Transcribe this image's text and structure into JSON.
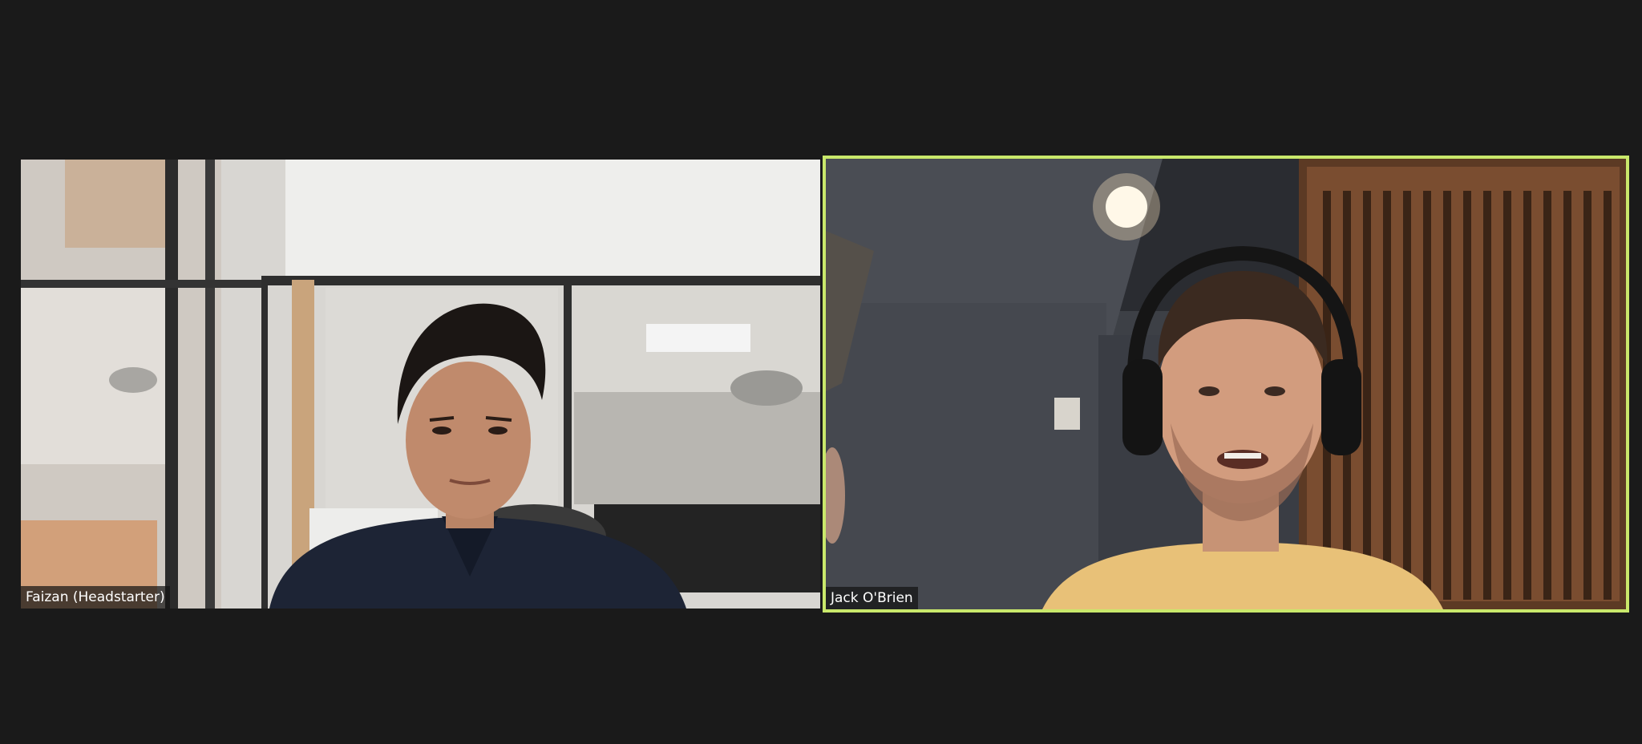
{
  "meeting": {
    "participants": [
      {
        "name": "Faizan (Headstarter)",
        "active_speaker": false,
        "video_scene": "young man in navy shirt seated in glass-walled office"
      },
      {
        "name": "Jack O'Brien",
        "active_speaker": true,
        "video_scene": "man wearing black headphones and yellow shirt in dark room with wooden slatted doors"
      }
    ],
    "colors": {
      "background": "#1a1a1a",
      "active_speaker_border": "#c9e86b",
      "name_tag_bg": "#141414",
      "name_tag_text": "#ffffff"
    }
  }
}
